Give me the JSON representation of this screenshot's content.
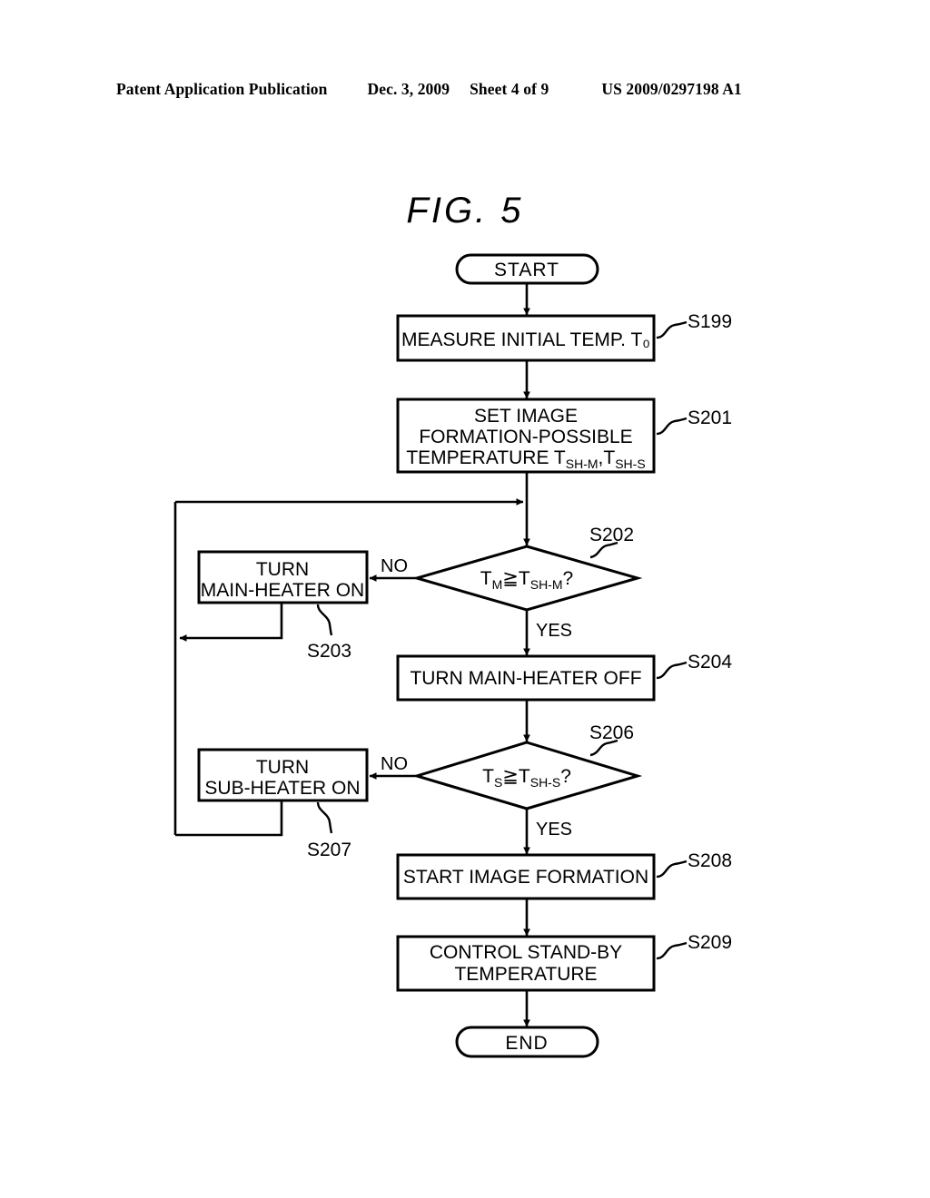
{
  "header": {
    "publication": "Patent Application Publication",
    "date": "Dec. 3, 2009",
    "sheet": "Sheet 4 of 9",
    "patent_number": "US 2009/0297198 A1"
  },
  "figure": {
    "title": "FIG.  5",
    "terminals": {
      "start": "START",
      "end": "END"
    },
    "branch_labels": {
      "no_main": "NO",
      "yes_main": "YES",
      "no_sub": "NO",
      "yes_sub": "YES"
    },
    "nodes": [
      {
        "id": "s199",
        "step": "S199",
        "lines": [
          "MEASURE INITIAL TEMP. T₀"
        ]
      },
      {
        "id": "s201",
        "step": "S201",
        "lines": [
          "SET IMAGE",
          "FORMATION-POSSIBLE",
          "TEMPERATURE T",
          "SH-M",
          ",T",
          "SH-S"
        ],
        "line1": "SET IMAGE",
        "line2": "FORMATION-POSSIBLE",
        "line3_main": "TEMPERATURE T",
        "line3_sub1": "SH-M",
        "line3_mid": ",T",
        "line3_sub2": "SH-S"
      },
      {
        "id": "s202",
        "step": "S202",
        "cond_main": "T",
        "cond_sub1": "M",
        "cond_op": "≧T",
        "cond_sub2": "SH-M",
        "cond_tail": "?"
      },
      {
        "id": "s203",
        "step": "S203",
        "line1": "TURN",
        "line2": "MAIN-HEATER ON"
      },
      {
        "id": "s204",
        "step": "S204",
        "line1": "TURN MAIN-HEATER OFF"
      },
      {
        "id": "s206",
        "step": "S206",
        "cond_main": "T",
        "cond_sub1": "S",
        "cond_op": "≧T",
        "cond_sub2": "SH-S",
        "cond_tail": "?"
      },
      {
        "id": "s207",
        "step": "S207",
        "line1": "TURN",
        "line2": "SUB-HEATER ON"
      },
      {
        "id": "s208",
        "step": "S208",
        "line1": "START IMAGE FORMATION"
      },
      {
        "id": "s209",
        "step": "S209",
        "line1": "CONTROL STAND-BY",
        "line2": "TEMPERATURE"
      }
    ]
  },
  "colors": {
    "ink": "#000000",
    "paper": "#ffffff"
  }
}
